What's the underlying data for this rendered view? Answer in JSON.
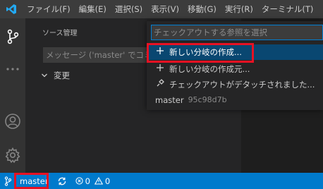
{
  "menubar": {
    "items": [
      "ファイル(F)",
      "編集(E)",
      "選択(S)",
      "表示(V)",
      "移動(G)",
      "実行(R)",
      "ターミナル(T)"
    ]
  },
  "activitybar": {
    "icons": [
      "source-control-icon",
      "more-icon",
      "account-icon",
      "settings-gear-icon"
    ]
  },
  "sidebar": {
    "title": "ソース管理",
    "message_placeholder": "メッセージ ('master' でコミット)",
    "changes_label": "変更"
  },
  "quickpick": {
    "placeholder": "チェックアウトする参照を選択",
    "items": [
      {
        "icon": "plus-icon",
        "label": "新しい分岐の作成..."
      },
      {
        "icon": "plus-icon",
        "label": "新しい分岐の作成元..."
      },
      {
        "icon": "debug-disconnect-icon",
        "label": "チェックアウトがデタッチされました..."
      },
      {
        "icon": "",
        "label": "master",
        "hash": "95c98d7b"
      }
    ]
  },
  "statusbar": {
    "branch": "master",
    "errors": "0",
    "warnings": "0"
  },
  "colors": {
    "accent": "#007acc",
    "selection": "#094771",
    "highlight": "#e81123"
  }
}
